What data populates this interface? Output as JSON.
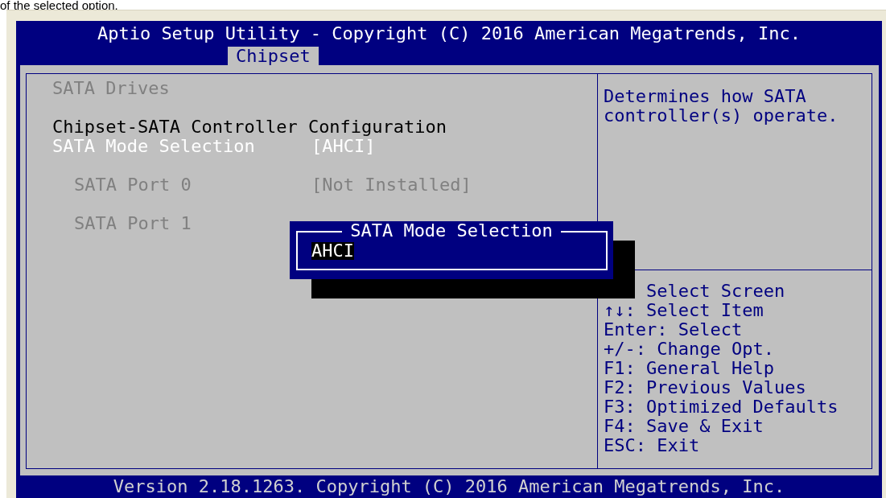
{
  "document_text": "of the selected option.",
  "window": {
    "title": "Aptio Setup Utility - Copyright (C) 2016 American Megatrends, Inc.",
    "tabs": [
      {
        "label": "Chipset",
        "selected": true
      }
    ]
  },
  "settings": [
    {
      "kind": "info",
      "label": "SATA Drives",
      "disabled": true,
      "selected": false
    },
    {
      "kind": "section",
      "label": "Chipset-SATA Controller Configuration",
      "children": [
        {
          "kind": "setting",
          "label": "SATA Mode Selection",
          "value": "[AHCI]",
          "disabled": false,
          "selected": true,
          "children": [
            {
              "kind": "setting",
              "label": "SATA Port 0",
              "value": "[Not Installed]",
              "disabled": true,
              "selected": false
            },
            {
              "kind": "setting",
              "label": "SATA Port 1",
              "disabled": true,
              "selected": false
            }
          ]
        }
      ]
    }
  ],
  "popup": {
    "title": "SATA Mode Selection",
    "options": [
      {
        "label": "AHCI",
        "selected": true
      }
    ]
  },
  "help": {
    "description": "Determines how SATA controller(s) operate.",
    "keys": [
      {
        "action": "Select Screen"
      },
      {
        "key": "↑↓:",
        "action": "Select Item"
      },
      {
        "key": "Enter:",
        "action": "Select"
      },
      {
        "key": "+/-:",
        "action": "Change Opt."
      },
      {
        "key": "F1:",
        "action": "General Help"
      },
      {
        "key": "F2:",
        "action": "Previous Values"
      },
      {
        "key": "F3:",
        "action": "Optimized Defaults"
      },
      {
        "key": "F4:",
        "action": "Save & Exit"
      },
      {
        "key": "ESC:",
        "action": "Exit"
      }
    ]
  },
  "footer": "Version 2.18.1263. Copyright (C) 2016 American Megatrends, Inc."
}
